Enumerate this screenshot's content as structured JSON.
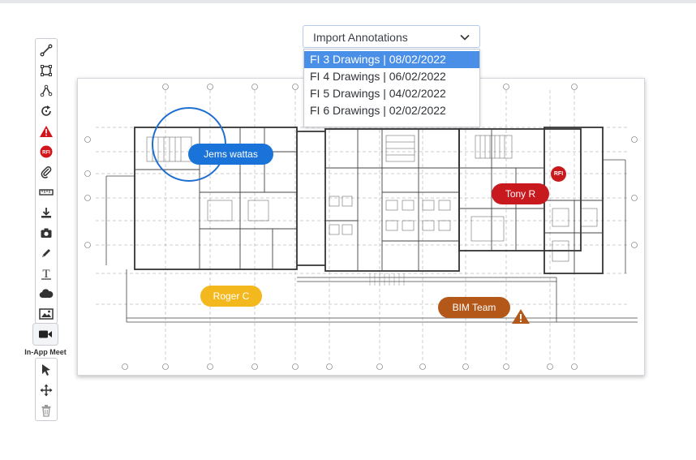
{
  "toolbar": {
    "tools": [
      {
        "icon": "line-tool-icon"
      },
      {
        "icon": "rectangle-tool-icon"
      },
      {
        "icon": "polyline-tool-icon"
      },
      {
        "icon": "rotate-icon"
      },
      {
        "icon": "issue-warning-icon"
      },
      {
        "icon": "rfi-icon",
        "text": "RFI"
      },
      {
        "icon": "attachment-icon"
      },
      {
        "icon": "measure-ruler-icon"
      },
      {
        "icon": "download-icon"
      },
      {
        "icon": "camera-icon"
      },
      {
        "icon": "pencil-icon"
      },
      {
        "icon": "text-tool-icon",
        "text": "T"
      },
      {
        "icon": "cloud-icon"
      },
      {
        "icon": "image-icon"
      }
    ],
    "meet_label": "In-App Meet",
    "bottom_tools": [
      {
        "icon": "select-pointer-icon"
      },
      {
        "icon": "move-icon"
      },
      {
        "icon": "trash-icon"
      }
    ]
  },
  "import": {
    "label": "Import Annotations",
    "options": [
      "FI 3 Drawings | 08/02/2022",
      "FI 4 Drawings | 06/02/2022",
      "FI 5 Drawings | 04/02/2022",
      "FI 6 Drawings | 02/02/2022"
    ],
    "selected_index": 0
  },
  "annotations": {
    "jems": "Jems wattas",
    "tony": "Tony R",
    "roger": "Roger C",
    "bim": "BIM Team",
    "rfi_badge": "RFI"
  },
  "colors": {
    "blue": "#1a73d9",
    "red": "#c8191f",
    "yellow": "#f4b81f",
    "brown": "#b4581a",
    "selected": "#4a8fe7"
  }
}
